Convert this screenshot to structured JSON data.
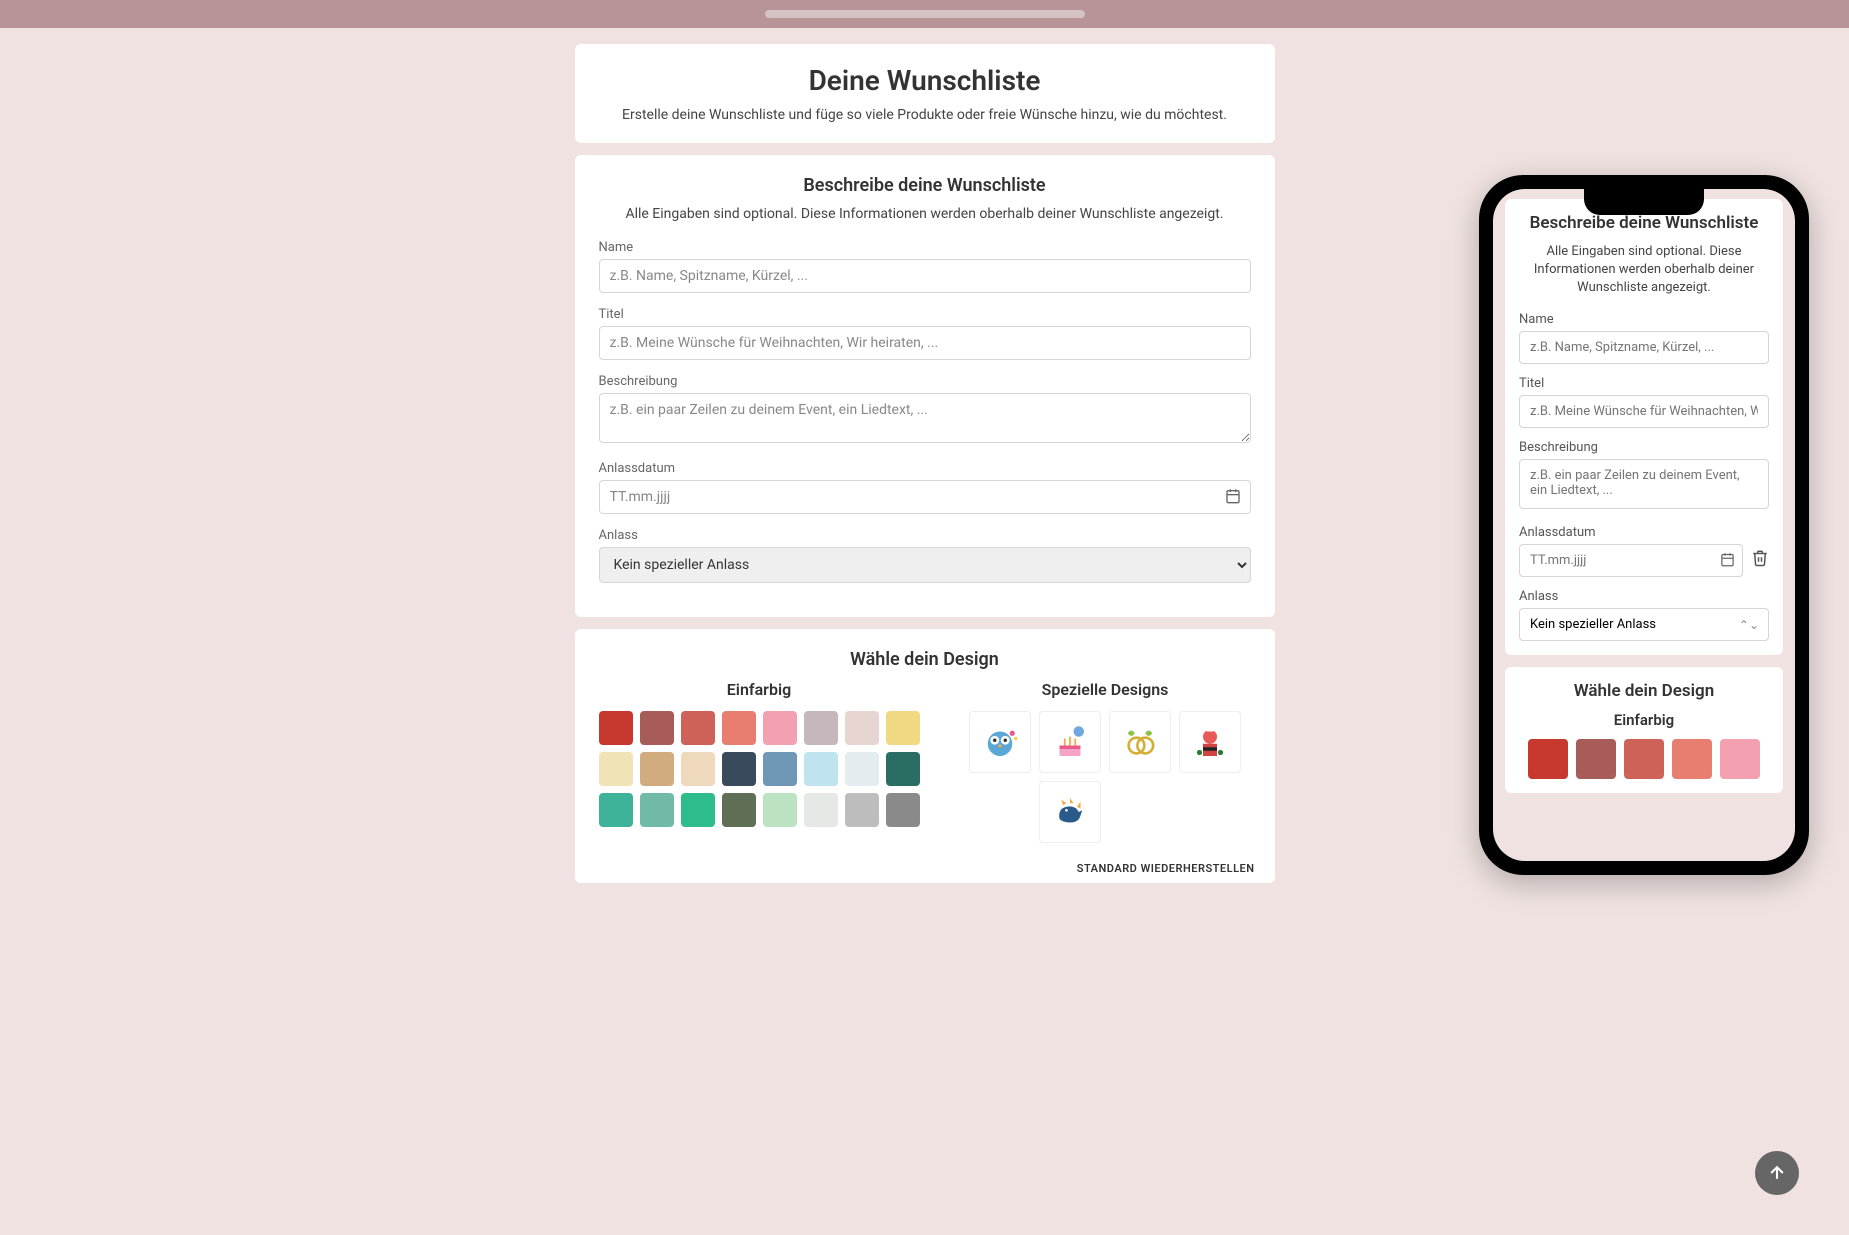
{
  "header": {
    "title": "Deine Wunschliste",
    "subtitle": "Erstelle deine Wunschliste und füge so viele Produkte oder freie Wünsche hinzu, wie du möchtest."
  },
  "form": {
    "title": "Beschreibe deine Wunschliste",
    "subtitle": "Alle Eingaben sind optional. Diese Informationen werden oberhalb deiner Wunschliste angezeigt.",
    "name_label": "Name",
    "name_placeholder": "z.B. Name, Spitzname, Kürzel, ...",
    "titel_label": "Titel",
    "titel_placeholder": "z.B. Meine Wünsche für Weihnachten, Wir heiraten, ...",
    "desc_label": "Beschreibung",
    "desc_placeholder": "z.B. ein paar Zeilen zu deinem Event, ein Liedtext, ...",
    "date_label": "Anlassdatum",
    "date_placeholder": "TT.mm.jjjj",
    "anlass_label": "Anlass",
    "anlass_value": "Kein spezieller Anlass"
  },
  "design": {
    "title": "Wähle dein Design",
    "solid_label": "Einfarbig",
    "special_label": "Spezielle Designs",
    "colors": [
      "#c7382f",
      "#a85c5a",
      "#cf6258",
      "#e77e6f",
      "#f3a1b1",
      "#c6b7bd",
      "#e7d5d1",
      "#f1d984",
      "#f0e3b5",
      "#d1ac7f",
      "#efd9bc",
      "#3a4a5c",
      "#6f97b6",
      "#bfe4f0",
      "#e4ecef",
      "#2a6e63",
      "#3fb39a",
      "#71baa7",
      "#2fbc8d",
      "#5e6f56",
      "#bce3c1",
      "#e5e9e6",
      "#bdbdbd",
      "#8a8a8a"
    ],
    "special_designs": [
      "owl",
      "birthday",
      "wedding",
      "christmas",
      "dinosaur"
    ],
    "restore_label": "STANDARD WIEDERHERSTELLEN"
  },
  "phone": {
    "form": {
      "title": "Beschreibe deine Wunschliste",
      "subtitle": "Alle Eingaben sind optional. Diese Informationen werden oberhalb deiner Wunschliste angezeigt.",
      "name_label": "Name",
      "name_placeholder": "z.B. Name, Spitzname, Kürzel, ...",
      "titel_label": "Titel",
      "titel_placeholder": "z.B. Meine Wünsche für Weihnachten, Wir he",
      "desc_label": "Beschreibung",
      "desc_placeholder": "z.B. ein paar Zeilen zu deinem Event, ein Liedtext, ...",
      "date_label": "Anlassdatum",
      "date_placeholder": "TT.mm.jjjj",
      "anlass_label": "Anlass",
      "anlass_value": "Kein spezieller Anlass"
    },
    "design": {
      "title": "Wähle dein Design",
      "solid_label": "Einfarbig",
      "colors": [
        "#c7382f",
        "#a85c5a",
        "#cf6258",
        "#e77e6f",
        "#f3a1b1"
      ]
    }
  }
}
